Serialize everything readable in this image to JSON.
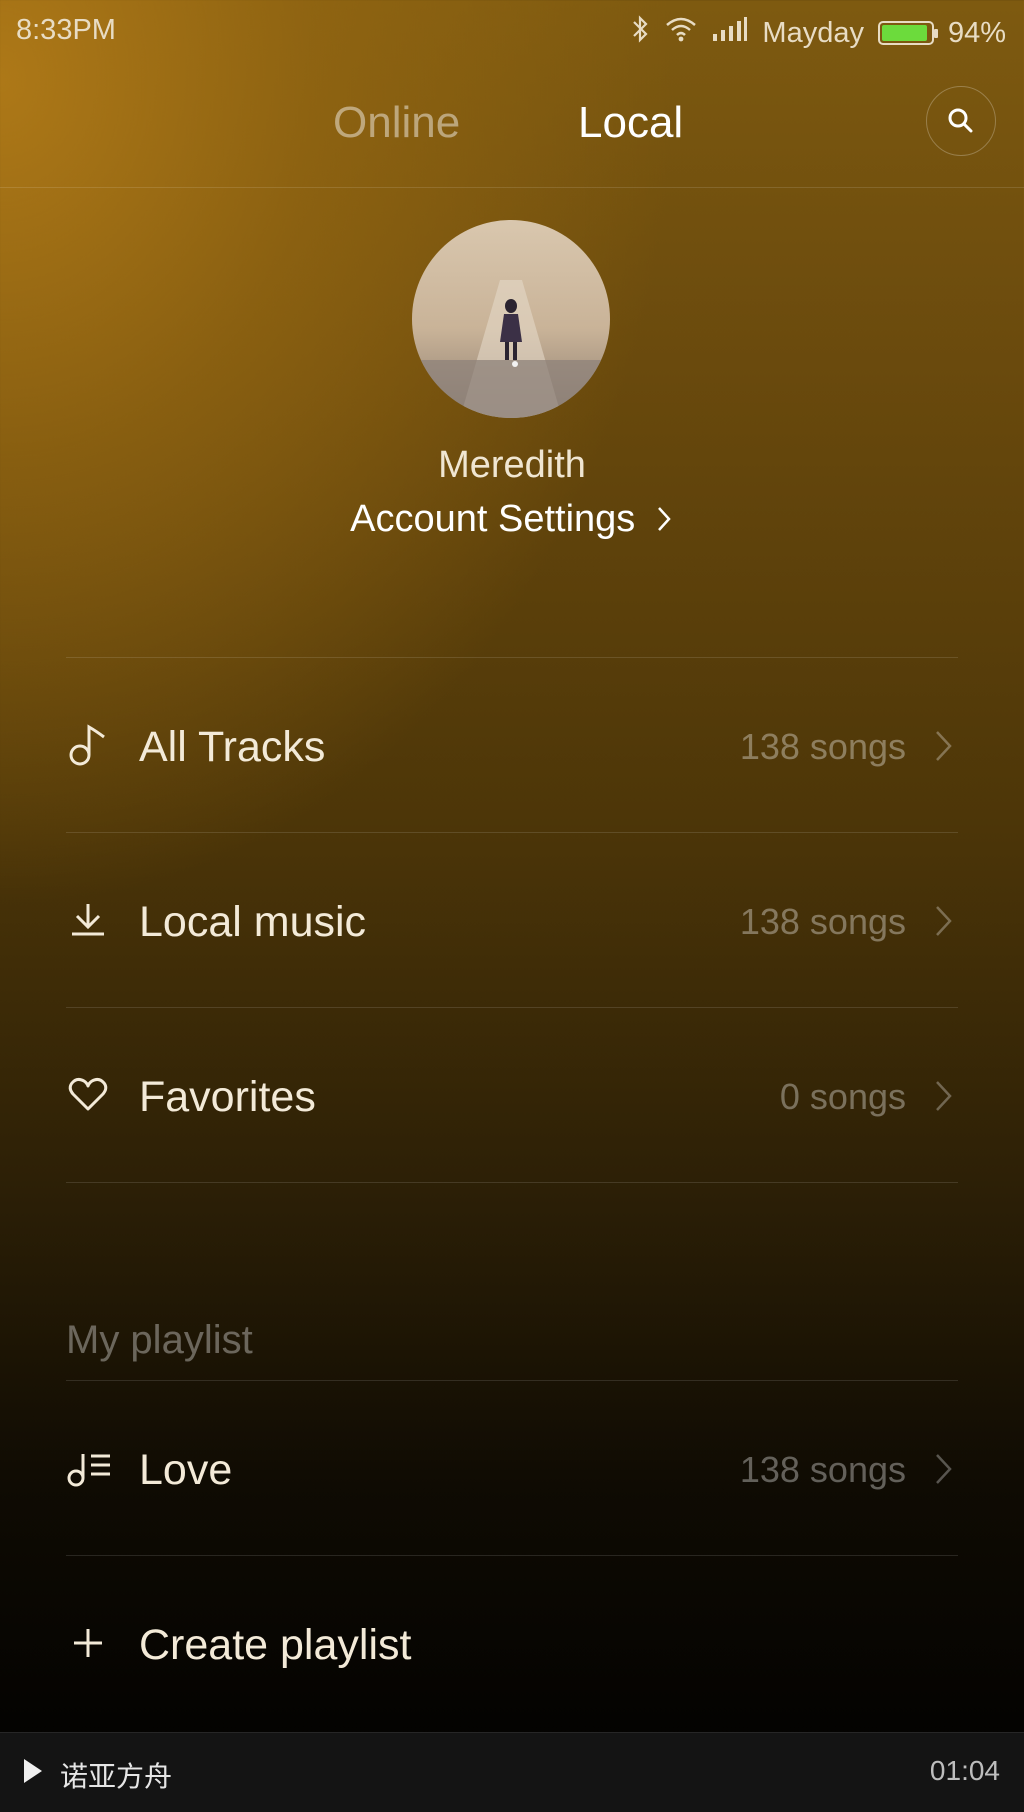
{
  "status_bar": {
    "time": "8:33PM",
    "carrier": "Mayday",
    "battery_percent": "94%",
    "battery_level": 0.94,
    "icons": [
      "bluetooth-icon",
      "wifi-icon",
      "signal-icon",
      "battery-icon"
    ]
  },
  "tabs": [
    {
      "label": "Online",
      "active": false
    },
    {
      "label": "Local",
      "active": true
    }
  ],
  "profile": {
    "name": "Meredith",
    "account_settings_label": "Account Settings",
    "account_settings_chevron": ">"
  },
  "library": [
    {
      "icon": "music-note-icon",
      "label": "All Tracks",
      "count": "138 songs"
    },
    {
      "icon": "download-icon",
      "label": "Local music",
      "count": "138 songs"
    },
    {
      "icon": "heart-icon",
      "label": "Favorites",
      "count": "0 songs"
    }
  ],
  "playlists": {
    "title": "My playlist",
    "items": [
      {
        "icon": "playlist-icon",
        "label": "Love",
        "count": "138 songs"
      }
    ],
    "create_label": "Create playlist"
  },
  "now_playing": {
    "track": "诺亚方舟",
    "time": "01:04"
  },
  "colors": {
    "accent_gold": "#b07a18",
    "battery_green": "#6cdb3c",
    "player_bg": "#141414"
  }
}
